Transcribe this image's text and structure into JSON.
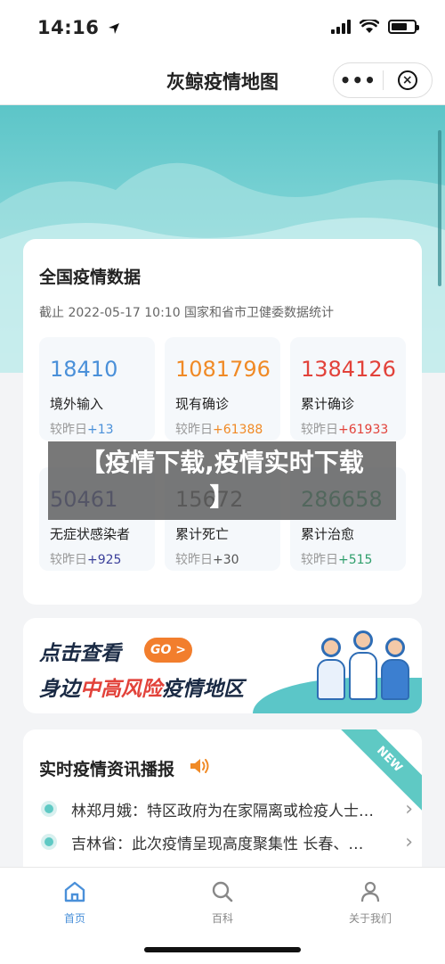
{
  "status_bar": {
    "time": "14:16",
    "icons": [
      "location-arrow-icon",
      "signal-icon",
      "wifi-icon",
      "battery-icon"
    ]
  },
  "nav": {
    "title": "灰鲸疫情地图",
    "more": "•••",
    "close": "×"
  },
  "stats": {
    "title": "全国疫情数据",
    "subtitle": "截止 2022-05-17 10:10 国家和省市卫健委数据统计",
    "items": [
      {
        "value": "18410",
        "label": "境外输入",
        "compare_prefix": "较昨日",
        "compare_delta": "+13",
        "color": "#4a90d9"
      },
      {
        "value": "1081796",
        "label": "现有确诊",
        "compare_prefix": "较昨日",
        "compare_delta": "+61388",
        "color": "#f08a26"
      },
      {
        "value": "1384126",
        "label": "累计确诊",
        "compare_prefix": "较昨日",
        "compare_delta": "+61933",
        "color": "#e2423a"
      },
      {
        "value": "50461",
        "label": "无症状感染者",
        "compare_prefix": "较昨日",
        "compare_delta": "+925",
        "color": "#3a3f9a"
      },
      {
        "value": "15672",
        "label": "累计死亡",
        "compare_prefix": "较昨日",
        "compare_delta": "+30",
        "color": "#555555"
      },
      {
        "value": "286658",
        "label": "累计治愈",
        "compare_prefix": "较昨日",
        "compare_delta": "+515",
        "color": "#2e9e6b"
      }
    ]
  },
  "caption": {
    "line1": "【疫情下载,疫情实时下载",
    "line2": "】"
  },
  "banner": {
    "line1": "点击查看",
    "go": "GO >",
    "line2_a": "身边",
    "line2_b": "中高风险",
    "line2_c": "疫情地区"
  },
  "news": {
    "title": "实时疫情资讯播报",
    "badge": "NEW",
    "items": [
      {
        "text": "林郑月娥：特区政府为在家隔离或检疫人士…"
      },
      {
        "text": "吉林省：此次疫情呈现高度聚集性 长春、…"
      }
    ]
  },
  "tabs": [
    {
      "label": "首页",
      "icon": "home-icon"
    },
    {
      "label": "百科",
      "icon": "search-icon"
    },
    {
      "label": "关于我们",
      "icon": "person-icon"
    }
  ]
}
